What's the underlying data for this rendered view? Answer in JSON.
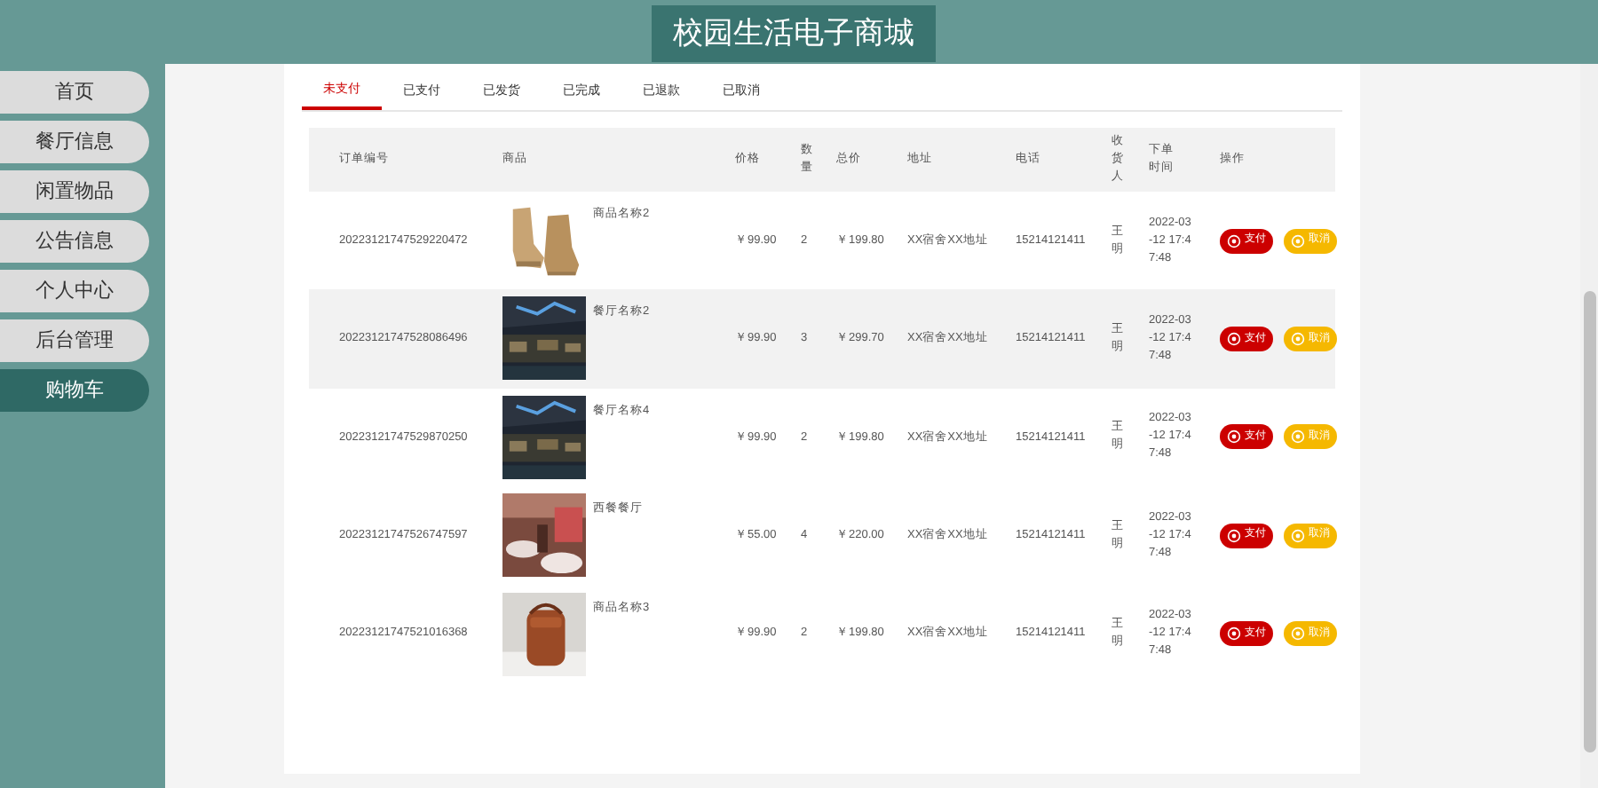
{
  "header": {
    "title": "校园生活电子商城"
  },
  "sidebar": {
    "items": [
      {
        "label": "首页",
        "selected": false
      },
      {
        "label": "餐厅信息",
        "selected": false
      },
      {
        "label": "闲置物品",
        "selected": false
      },
      {
        "label": "公告信息",
        "selected": false
      },
      {
        "label": "个人中心",
        "selected": false
      },
      {
        "label": "后台管理",
        "selected": false
      },
      {
        "label": "购物车",
        "selected": true
      }
    ]
  },
  "tabs": [
    {
      "label": "未支付",
      "selected": true
    },
    {
      "label": "已支付",
      "selected": false
    },
    {
      "label": "已发货",
      "selected": false
    },
    {
      "label": "已完成",
      "selected": false
    },
    {
      "label": "已退款",
      "selected": false
    },
    {
      "label": "已取消",
      "selected": false
    }
  ],
  "table": {
    "columns": [
      "订单编号",
      "商品",
      "价格",
      "数量",
      "总价",
      "地址",
      "电话",
      "收货人",
      "下单时间",
      "操作"
    ],
    "rows": [
      {
        "order_no": "20223121747529220472",
        "goods": "商品名称2",
        "price": "￥99.90",
        "qty": "2",
        "total": "￥199.80",
        "address": "XX宿舍XX地址",
        "phone": "15214121411",
        "receiver": "王明",
        "time": "2022-03-12 17:47:48",
        "highlighted": false,
        "actions": [
          "支付",
          "取消"
        ]
      },
      {
        "order_no": "20223121747528086496",
        "goods": "餐厅名称2",
        "price": "￥99.90",
        "qty": "3",
        "total": "￥299.70",
        "address": "XX宿舍XX地址",
        "phone": "15214121411",
        "receiver": "王明",
        "time": "2022-03-12 17:47:48",
        "highlighted": true,
        "actions": [
          "支付",
          "取消"
        ]
      },
      {
        "order_no": "20223121747529870250",
        "goods": "餐厅名称4",
        "price": "￥99.90",
        "qty": "2",
        "total": "￥199.80",
        "address": "XX宿舍XX地址",
        "phone": "15214121411",
        "receiver": "王明",
        "time": "2022-03-12 17:47:48",
        "highlighted": false,
        "actions": [
          "支付",
          "取消"
        ]
      },
      {
        "order_no": "20223121747526747597",
        "goods": "西餐餐厅",
        "price": "￥55.00",
        "qty": "4",
        "total": "￥220.00",
        "address": "XX宿舍XX地址",
        "phone": "15214121411",
        "receiver": "王明",
        "time": "2022-03-12 17:47:48",
        "highlighted": false,
        "actions": [
          "支付",
          "取消"
        ]
      },
      {
        "order_no": "20223121747521016368",
        "goods": "商品名称3",
        "price": "￥99.90",
        "qty": "2",
        "total": "￥199.80",
        "address": "XX宿舍XX地址",
        "phone": "15214121411",
        "receiver": "王明",
        "time": "2022-03-12 17:47:48",
        "highlighted": false,
        "actions": [
          "支付",
          "取消"
        ]
      }
    ]
  }
}
